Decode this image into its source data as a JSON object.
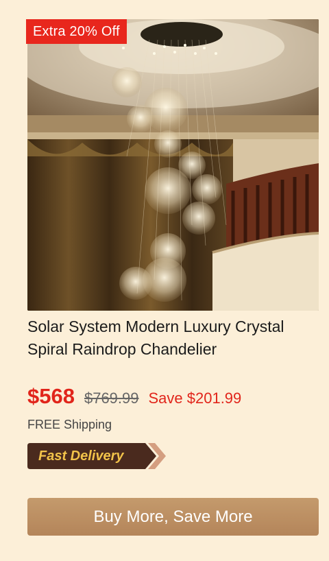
{
  "product": {
    "badge": "Extra 20% Off",
    "title": "Solar System Modern Luxury Crystal Spiral Raindrop Chandelier",
    "price": "$568",
    "original_price": "$769.99",
    "savings": "Save $201.99",
    "shipping": "FREE Shipping",
    "delivery_tag": "Fast Delivery",
    "cta_label": "Buy More, Save More"
  },
  "colors": {
    "background": "#fcefd8",
    "accent_red": "#e1251b",
    "cta": "#bb8d62",
    "delivery_tag_bg": "#4a2a1e",
    "delivery_tag_text": "#f2c34a"
  }
}
